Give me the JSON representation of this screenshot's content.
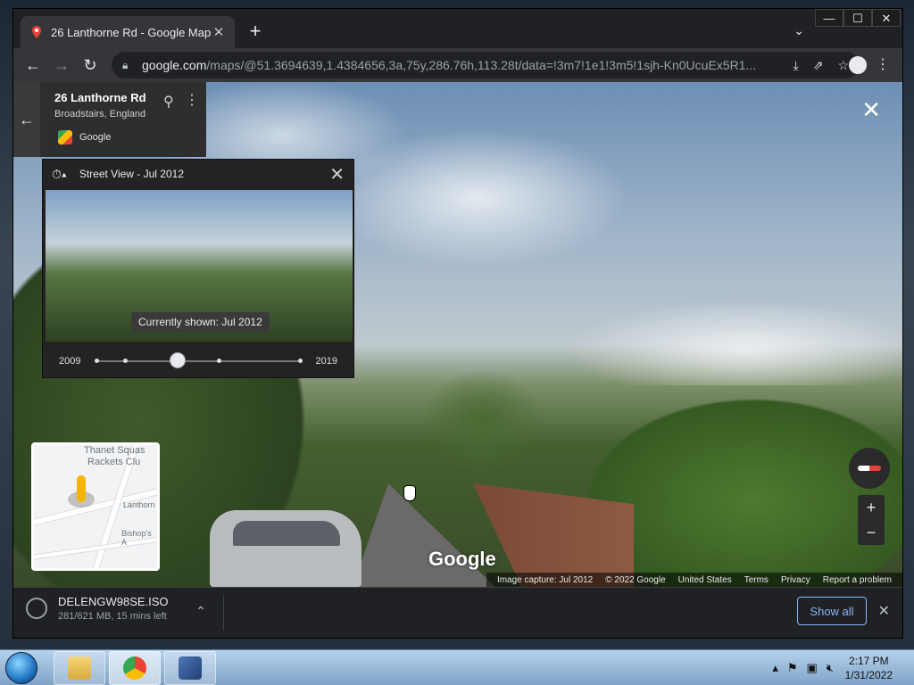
{
  "browser": {
    "tab": {
      "title": "26 Lanthorne Rd - Google Maps",
      "close": "✕"
    },
    "new_tab": "+",
    "window_buttons": {
      "minimize": "—",
      "maximize": "☐",
      "close": "✕"
    },
    "nav": {
      "back": "←",
      "forward": "→",
      "reload": "↻"
    },
    "address": {
      "host": "google.com",
      "rest": "/maps/@51.3694639,1.4384656,3a,75y,286.76h,113.28t/data=!3m7!1e1!3m5!1sjh-Kn0UcuEx5R1..."
    },
    "menu": "⋮"
  },
  "streetview": {
    "close": "✕",
    "google_logo": "Google",
    "footer": [
      "Image capture: Jul 2012",
      "© 2022 Google",
      "United States",
      "Terms",
      "Privacy",
      "Report a problem"
    ]
  },
  "info_card": {
    "back": "←",
    "title": "26 Lanthorne Rd",
    "subtitle": "Broadstairs, England",
    "source": "Google"
  },
  "time_panel": {
    "title": "Street View - Jul 2012",
    "close": "✕",
    "tooltip": "Currently shown: Jul 2012",
    "start_year": "2009",
    "end_year": "2019",
    "ticks": [
      0,
      0.14,
      0.6,
      1.0
    ],
    "selected_fraction": 0.4
  },
  "minimap": {
    "labels": [
      "Thanet Squas",
      "Rackets Clu",
      "Lanthorn",
      "Bishop's A"
    ]
  },
  "zoom": {
    "in": "+",
    "out": "−"
  },
  "download": {
    "filename": "DELENGW98SE.ISO",
    "status": "281/621 MB, 15 mins left",
    "show_all": "Show all",
    "close": "✕"
  },
  "taskbar": {
    "clock_time": "2:17 PM",
    "clock_date": "1/31/2022"
  }
}
